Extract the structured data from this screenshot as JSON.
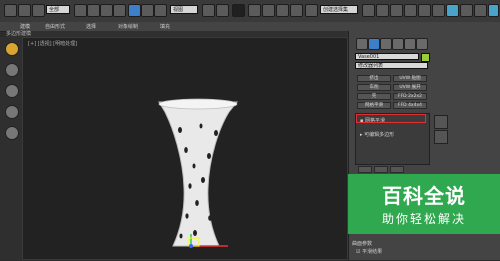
{
  "toolbar": {
    "selection_filter": "全部",
    "view_dropdown": "视图",
    "named_selection": "创建选择集"
  },
  "menubar": {
    "items": [
      "建模",
      "自由形式",
      "选择",
      "对象绘制",
      "填充"
    ]
  },
  "subbar": {
    "label": "多边形建模"
  },
  "viewport": {
    "label": "[+] [透视] [明暗处理]"
  },
  "panel": {
    "object_name": "Vase001",
    "modifier_list": "修改器列表",
    "buttons": [
      [
        "挤出",
        "UVW 贴图"
      ],
      [
        "车削",
        "UVW 展开"
      ],
      [
        "壳",
        "FFD 2x2x2"
      ],
      [
        "网格平滑",
        "FFD 4x4x4"
      ]
    ],
    "stack": {
      "items": [
        "网格平滑",
        "可编辑多边形"
      ]
    },
    "bottom_section_title": "曲面参数",
    "bottom_option": "平滑结果"
  },
  "watermark": {
    "title": "百科全说",
    "subtitle": "助你轻松解决"
  },
  "colors": {
    "highlight": "#e23030",
    "watermark": "#2fa84f",
    "object_swatch": "#9ccc3a"
  }
}
